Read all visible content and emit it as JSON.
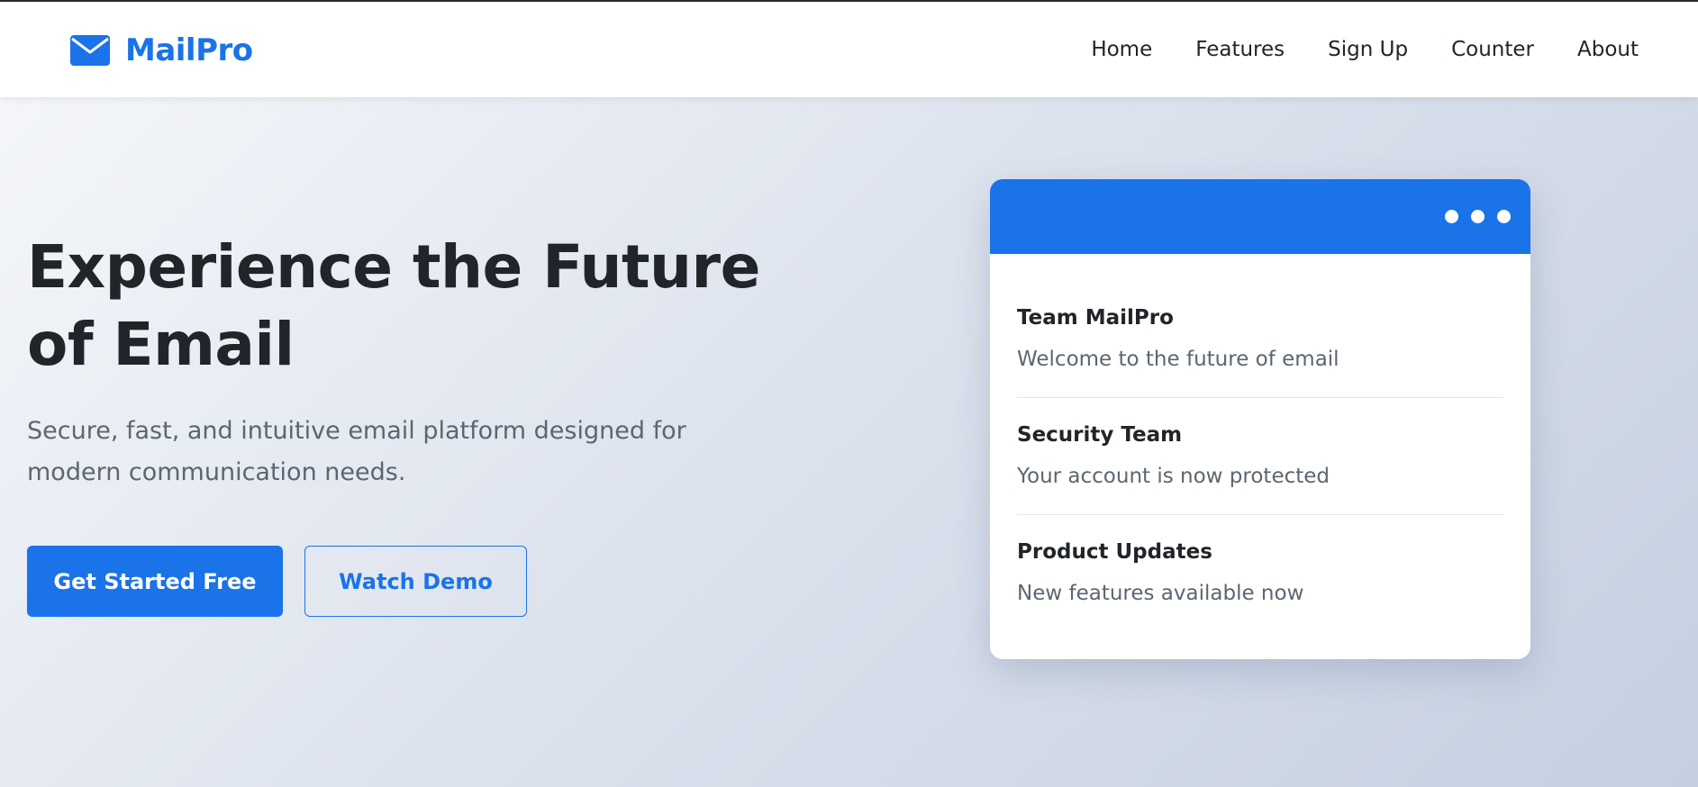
{
  "brand": {
    "name": "MailPro",
    "icon": "envelope-icon",
    "color": "#1a73e8"
  },
  "nav": {
    "items": [
      {
        "label": "Home"
      },
      {
        "label": "Features"
      },
      {
        "label": "Sign Up"
      },
      {
        "label": "Counter"
      },
      {
        "label": "About"
      }
    ]
  },
  "hero": {
    "title": "Experience the Future of Email",
    "subtitle": "Secure, fast, and intuitive email platform designed for modern communication needs.",
    "primary_button": "Get Started Free",
    "secondary_button": "Watch Demo"
  },
  "preview_card": {
    "header_color": "#1a73e8",
    "messages": [
      {
        "sender": "Team MailPro",
        "subject": "Welcome to the future of email"
      },
      {
        "sender": "Security Team",
        "subject": "Your account is now protected"
      },
      {
        "sender": "Product Updates",
        "subject": "New features available now"
      }
    ]
  }
}
